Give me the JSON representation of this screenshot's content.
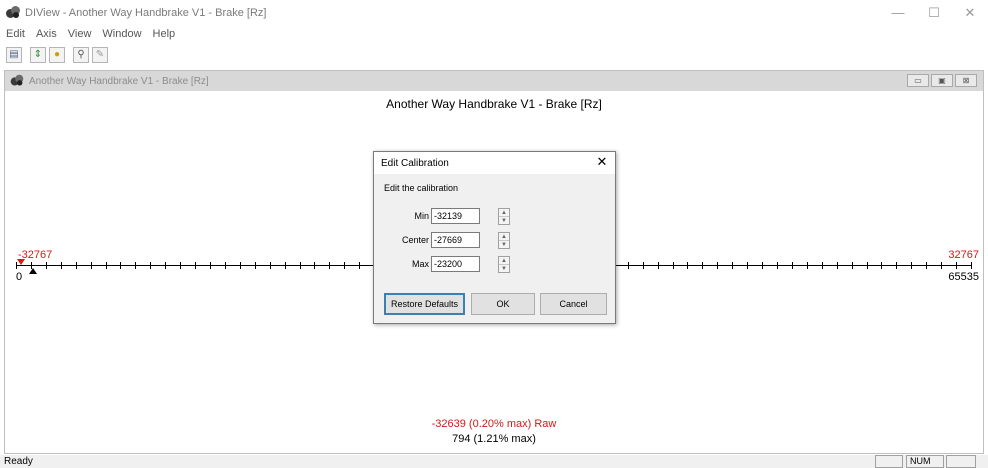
{
  "app": {
    "title": "DIView - Another Way Handbrake V1 - Brake [Rz]",
    "window_controls": {
      "minimize": "—",
      "maximize": "☐",
      "close": "✕"
    }
  },
  "menu": [
    "Edit",
    "Axis",
    "View",
    "Window",
    "Help"
  ],
  "toolbar": {
    "icons": [
      "save-icon",
      "updown-icon",
      "joystick-icon",
      "search-icon",
      "edit-icon"
    ],
    "glyphs": {
      "save": "▤",
      "updown": "⇕",
      "joystick": "●",
      "search": "⚲",
      "edit": "✎"
    }
  },
  "child_window": {
    "title": "Another Way Handbrake V1 - Brake [Rz]",
    "controls": {
      "minimize": "▭",
      "restore": "▣",
      "close": "⊠"
    }
  },
  "plot": {
    "title": "Another Way Handbrake V1 - Brake [Rz]",
    "left_top_label": "-32767",
    "left_bottom_label": "0",
    "right_top_label": "32767",
    "right_bottom_label": "65535",
    "readout_raw": "-32639 (0.20% max)  Raw",
    "readout_value": "794 (1.21% max)",
    "colors": {
      "red": "#d11a1a",
      "black": "#000000"
    }
  },
  "dialog": {
    "title": "Edit Calibration",
    "close": "✕",
    "caption": "Edit the calibration",
    "fields": [
      {
        "label": "Min",
        "value": "-32139"
      },
      {
        "label": "Center",
        "value": "-27669"
      },
      {
        "label": "Max",
        "value": "-23200"
      }
    ],
    "buttons": {
      "restore": "Restore Defaults",
      "ok": "OK",
      "cancel": "Cancel"
    },
    "spinner": {
      "up": "▲",
      "down": "▼"
    }
  },
  "status": {
    "text": "Ready",
    "num": "NUM"
  }
}
